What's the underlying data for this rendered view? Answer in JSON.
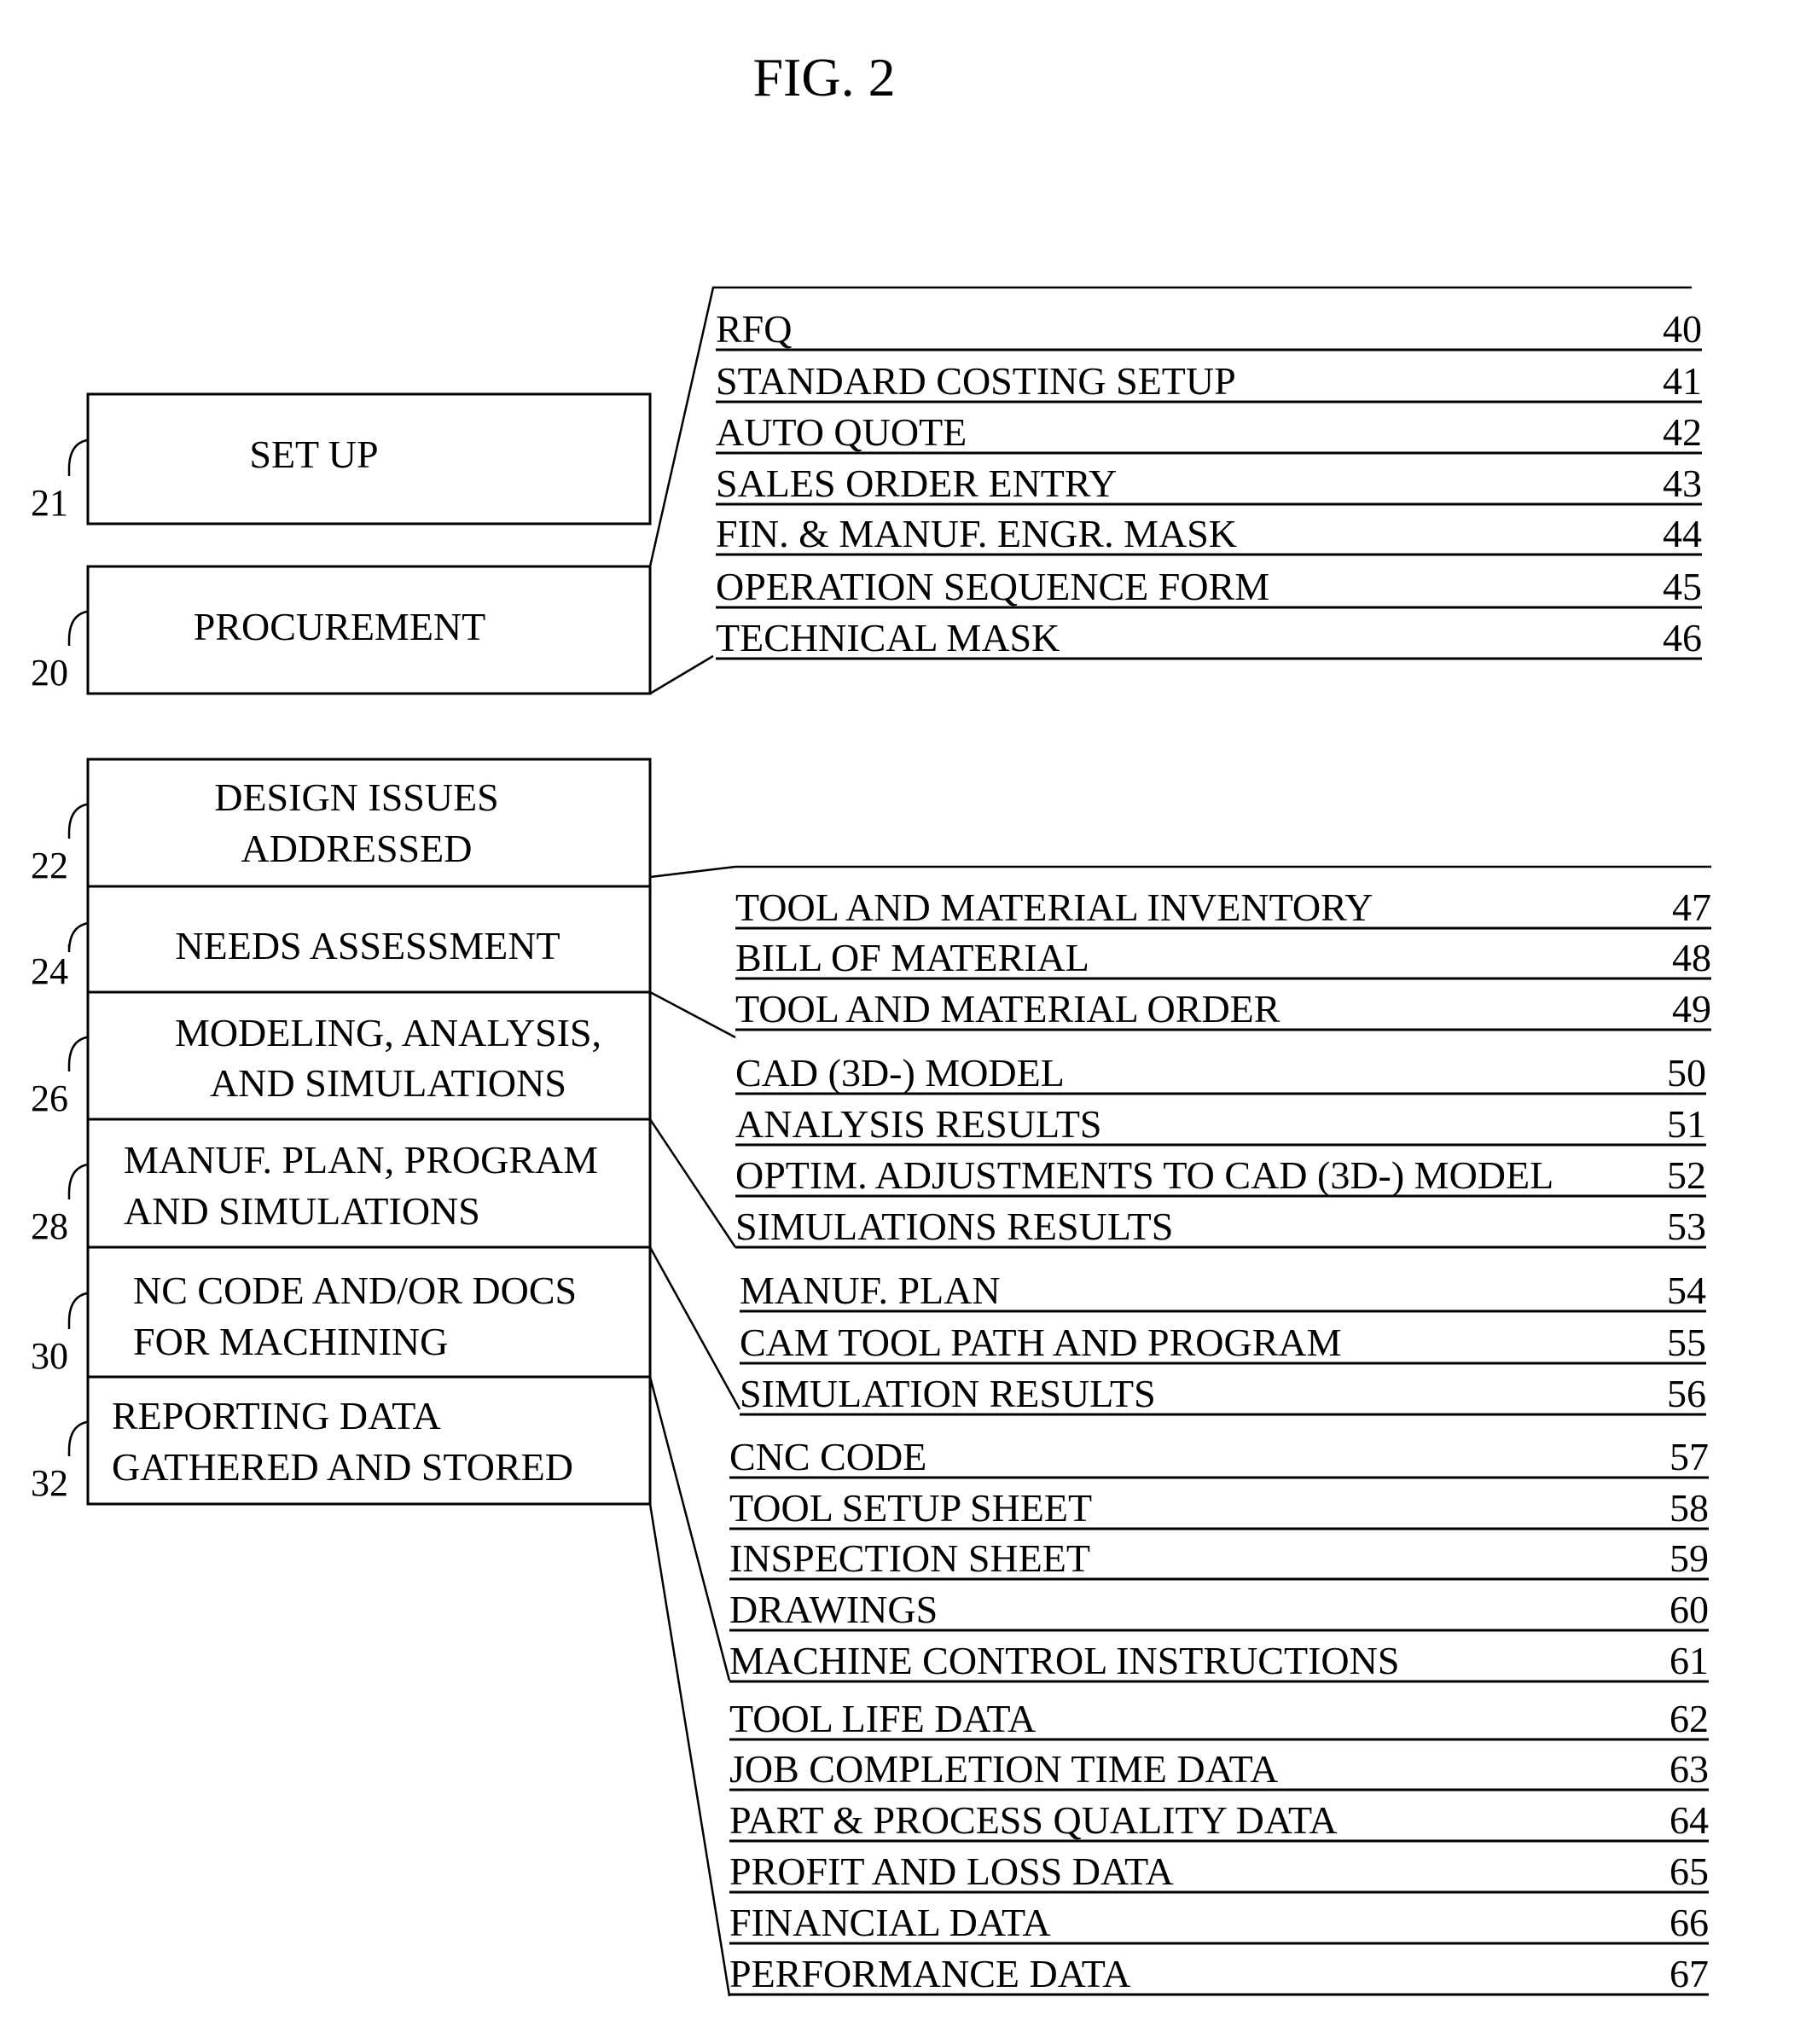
{
  "figure": {
    "title": "FIG. 2",
    "left_boxes": [
      {
        "ref": "21",
        "lines": [
          "SET UP"
        ]
      },
      {
        "ref": "20",
        "lines": [
          "PROCUREMENT"
        ]
      },
      {
        "ref": "22",
        "lines": [
          "DESIGN ISSUES",
          "ADDRESSED"
        ]
      },
      {
        "ref": "24",
        "lines": [
          "NEEDS ASSESSMENT"
        ]
      },
      {
        "ref": "26",
        "lines": [
          "MODELING, ANALYSIS,",
          "AND SIMULATIONS"
        ]
      },
      {
        "ref": "28",
        "lines": [
          "MANUF. PLAN, PROGRAM",
          "AND SIMULATIONS"
        ]
      },
      {
        "ref": "30",
        "lines": [
          "NC CODE AND/OR  DOCS",
          "FOR MACHINING"
        ]
      },
      {
        "ref": "32",
        "lines": [
          "REPORTING DATA",
          "GATHERED AND STORED"
        ]
      }
    ],
    "item_groups": [
      {
        "name": "procurement-items",
        "items": [
          {
            "label": "RFQ",
            "num": "40"
          },
          {
            "label": "STANDARD COSTING SETUP",
            "num": "41"
          },
          {
            "label": "AUTO QUOTE",
            "num": "42"
          },
          {
            "label": "SALES ORDER ENTRY",
            "num": "43"
          },
          {
            "label": "FIN. & MANUF. ENGR. MASK",
            "num": "44"
          },
          {
            "label": "OPERATION SEQUENCE FORM",
            "num": "45"
          },
          {
            "label": "TECHNICAL MASK",
            "num": "46"
          }
        ]
      },
      {
        "name": "needs-assessment-items",
        "items": [
          {
            "label": "TOOL AND MATERIAL INVENTORY",
            "num": "47"
          },
          {
            "label": "BILL OF MATERIAL",
            "num": "48"
          },
          {
            "label": "TOOL AND MATERIAL ORDER",
            "num": "49"
          }
        ]
      },
      {
        "name": "modeling-items",
        "items": [
          {
            "label": "CAD (3D-) MODEL",
            "num": "50"
          },
          {
            "label": "ANALYSIS RESULTS",
            "num": "51"
          },
          {
            "label": "OPTIM. ADJUSTMENTS TO CAD (3D-) MODEL",
            "num": "52"
          },
          {
            "label": "SIMULATIONS RESULTS",
            "num": "53"
          }
        ]
      },
      {
        "name": "manuf-plan-items",
        "items": [
          {
            "label": "MANUF. PLAN",
            "num": "54"
          },
          {
            "label": "CAM TOOL PATH AND PROGRAM",
            "num": "55"
          },
          {
            "label": "SIMULATION RESULTS",
            "num": "56"
          }
        ]
      },
      {
        "name": "nc-code-items",
        "items": [
          {
            "label": "CNC CODE",
            "num": "57"
          },
          {
            "label": "TOOL SETUP SHEET",
            "num": "58"
          },
          {
            "label": "INSPECTION SHEET",
            "num": "59"
          },
          {
            "label": "DRAWINGS",
            "num": "60"
          },
          {
            "label": "MACHINE CONTROL INSTRUCTIONS",
            "num": "61"
          }
        ]
      },
      {
        "name": "reporting-items",
        "items": [
          {
            "label": "TOOL LIFE DATA",
            "num": "62"
          },
          {
            "label": "JOB COMPLETION TIME DATA",
            "num": "63"
          },
          {
            "label": "PART & PROCESS QUALITY DATA",
            "num": "64"
          },
          {
            "label": "PROFIT AND LOSS DATA",
            "num": "65"
          },
          {
            "label": "FINANCIAL DATA",
            "num": "66"
          },
          {
            "label": "PERFORMANCE DATA",
            "num": "67"
          }
        ]
      }
    ]
  }
}
